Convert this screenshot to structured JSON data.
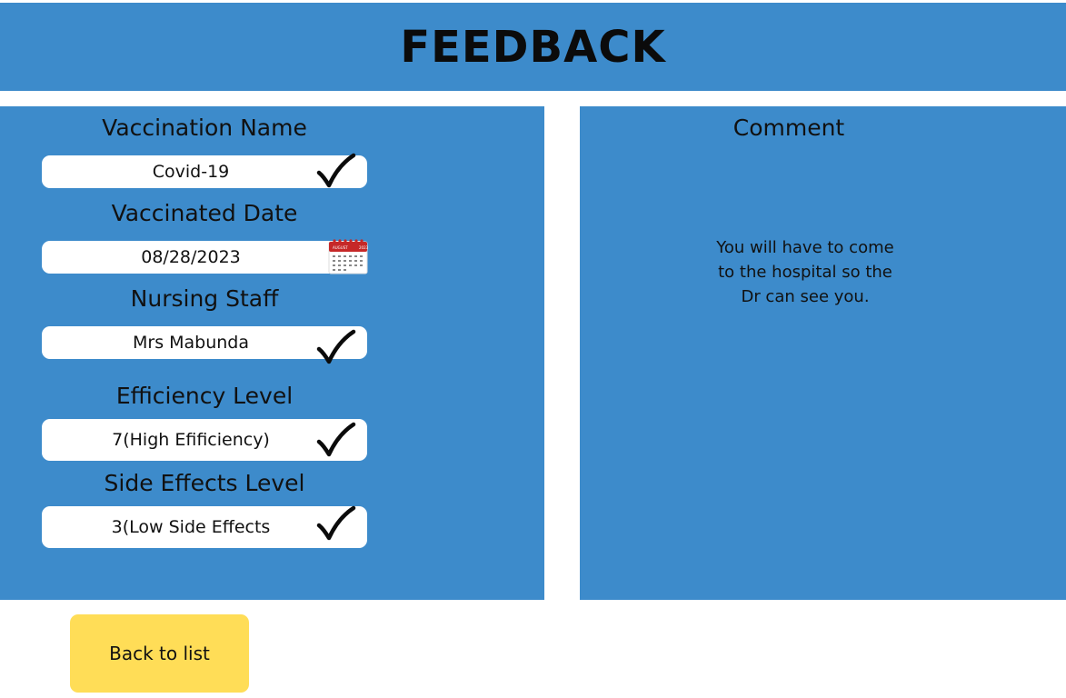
{
  "header": {
    "title": "FEEDBACK"
  },
  "form": {
    "vaccination_name": {
      "label": "Vaccination Name",
      "value": "Covid-19"
    },
    "vaccinated_date": {
      "label": "Vaccinated Date",
      "value": "08/28/2023"
    },
    "nursing_staff": {
      "label": "Nursing Staff",
      "value": "Mrs Mabunda"
    },
    "efficiency_level": {
      "label": "Efficiency Level",
      "value": "7(High Efificiency)"
    },
    "side_effects_level": {
      "label": "Side Effects Level",
      "value": "3(Low Side Effects"
    }
  },
  "comment": {
    "title": "Comment",
    "lines": [
      "You will  have to come",
      "to the hospital so the",
      "Dr can see you."
    ]
  },
  "calendar_icon": {
    "month": "AUGUST",
    "year": "2023"
  },
  "buttons": {
    "back": "Back to list"
  },
  "colors": {
    "panel": "#3d8bcb",
    "button": "#ffdd57",
    "calendar_red": "#c62828"
  }
}
